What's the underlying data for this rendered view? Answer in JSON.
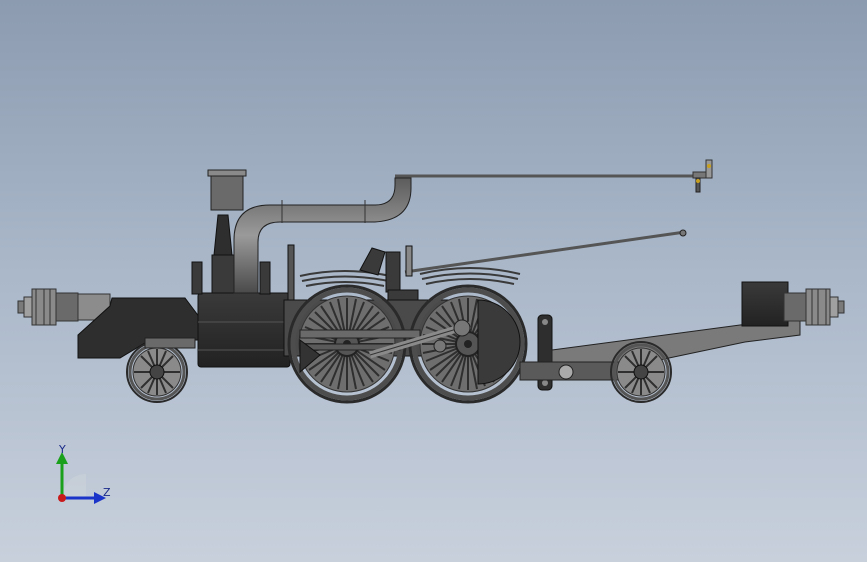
{
  "viewport": {
    "background_top": "#8c9bb0",
    "background_bottom": "#c8d0dc"
  },
  "model": {
    "part_color": "#7a7a7a",
    "dark_color": "#2e2e2e",
    "mid_color": "#5a5a5a"
  },
  "triad": {
    "y_label": "Y",
    "z_label": "Z",
    "y_color": "#1aa01a",
    "z_color": "#1a33c8",
    "origin_color": "#c81a1a"
  }
}
